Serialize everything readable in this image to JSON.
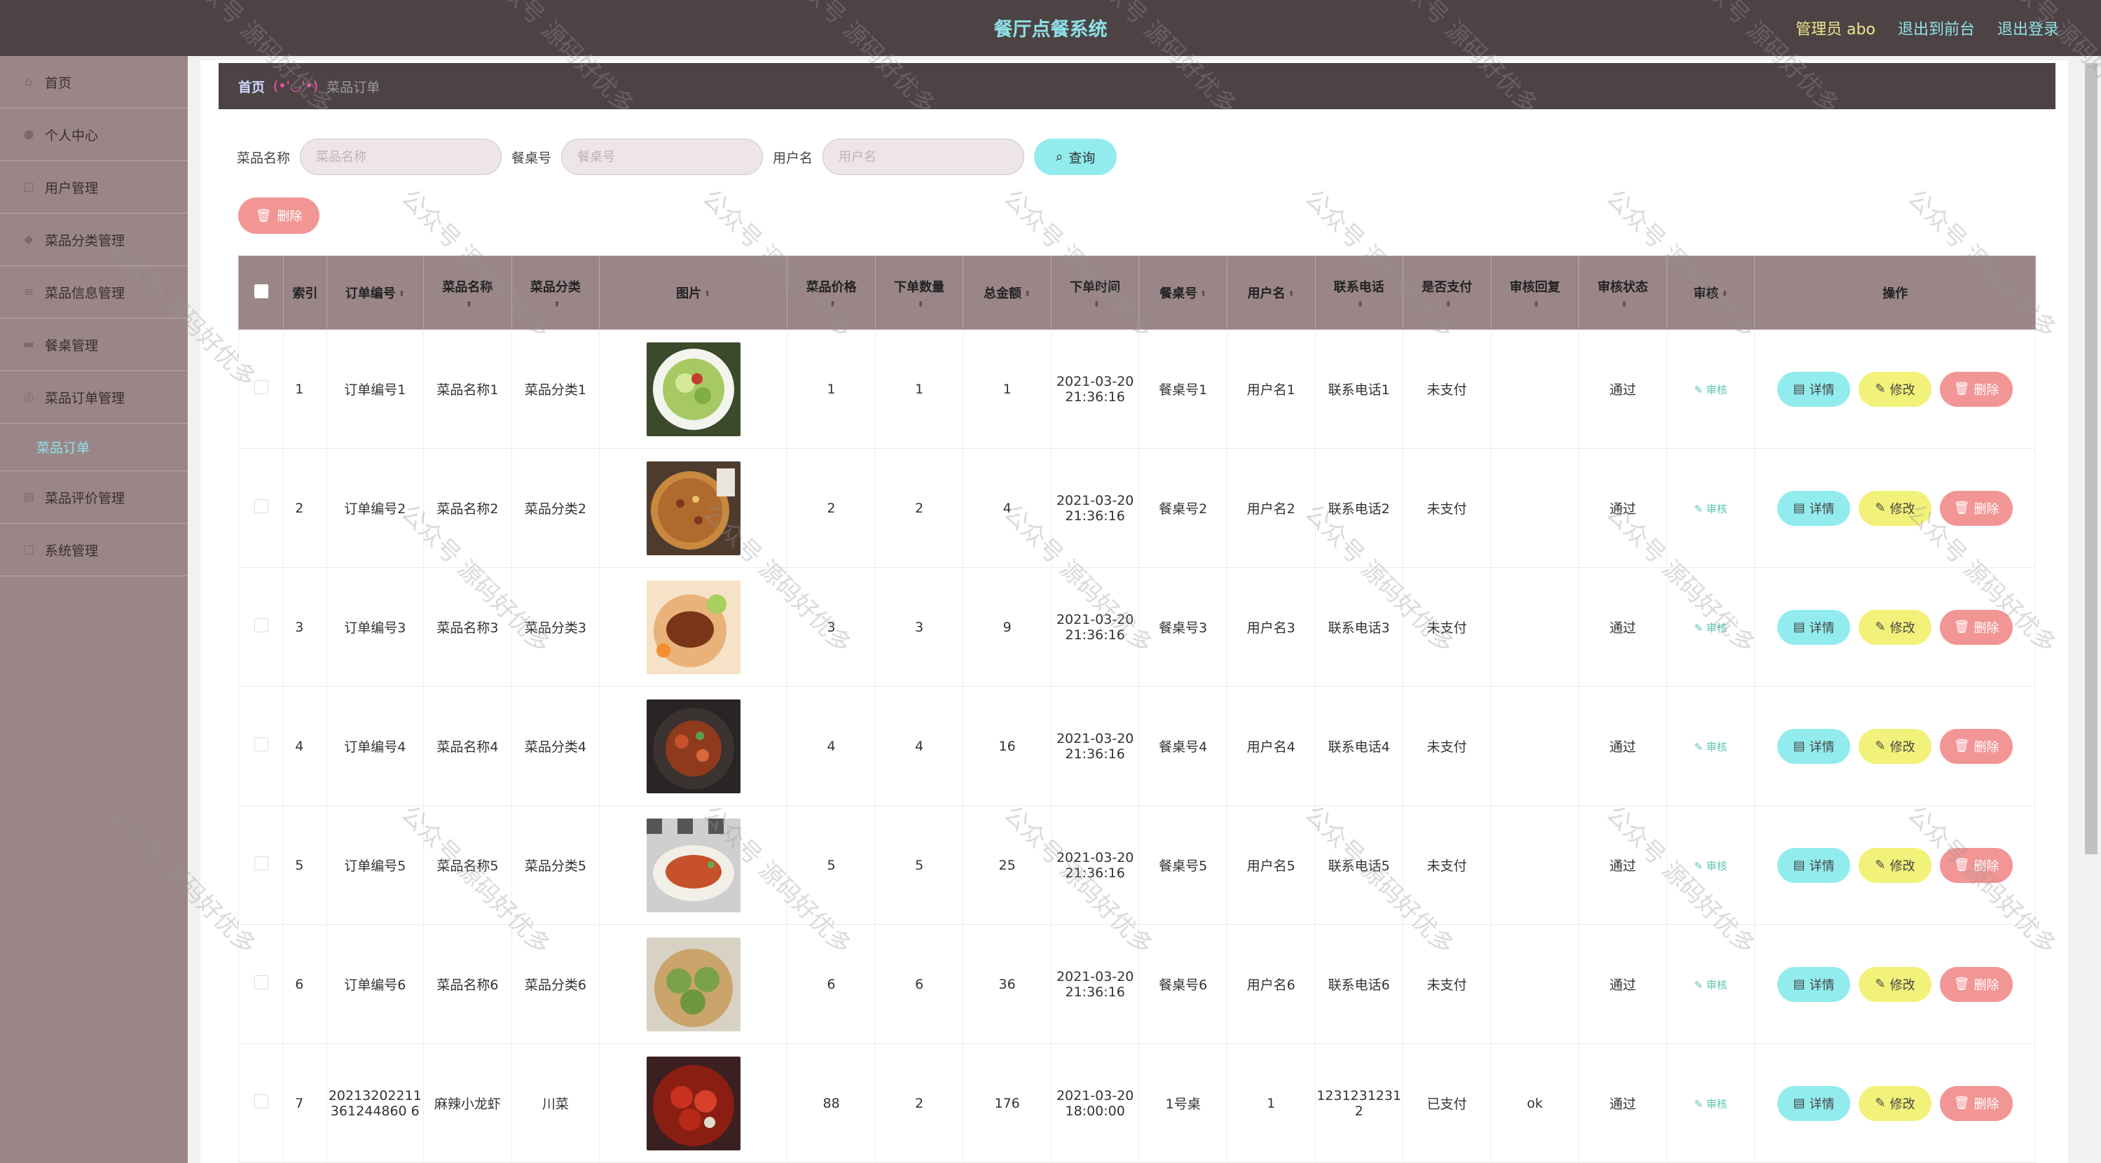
{
  "header": {
    "title": "餐厅点餐系统",
    "admin_label": "管理员 abo",
    "to_front": "退出到前台",
    "logout": "退出登录"
  },
  "sidebar": {
    "items": [
      {
        "label": "首页",
        "icon": "home-icon"
      },
      {
        "label": "个人中心",
        "icon": "user-icon"
      },
      {
        "label": "用户管理",
        "icon": "users-icon"
      },
      {
        "label": "菜品分类管理",
        "icon": "tag-icon"
      },
      {
        "label": "菜品信息管理",
        "icon": "list-icon"
      },
      {
        "label": "餐桌管理",
        "icon": "table-icon"
      },
      {
        "label": "菜品订单管理",
        "icon": "order-icon"
      }
    ],
    "sub_item": "菜品订单",
    "items_after": [
      {
        "label": "菜品评价管理",
        "icon": "comment-icon"
      },
      {
        "label": "系统管理",
        "icon": "settings-icon"
      }
    ]
  },
  "breadcrumb": {
    "home": "首页",
    "separator": "(•'◡'•)",
    "current": "菜品订单"
  },
  "search": {
    "dish_label": "菜品名称",
    "dish_placeholder": "菜品名称",
    "table_label": "餐桌号",
    "table_placeholder": "餐桌号",
    "user_label": "用户名",
    "user_placeholder": "用户名",
    "query_button": "查询"
  },
  "delete_button": "删除",
  "table": {
    "headers": [
      "索引",
      "订单编号",
      "菜品名称",
      "菜品分类",
      "图片",
      "菜品价格",
      "下单数量",
      "总金额",
      "下单时间",
      "餐桌号",
      "用户名",
      "联系电话",
      "是否支付",
      "审核回复",
      "审核状态",
      "审核",
      "操作"
    ],
    "action_labels": {
      "audit": "审核",
      "detail": "详情",
      "edit": "修改",
      "delete": "删除"
    },
    "rows": [
      {
        "idx": "1",
        "order": "订单编号1",
        "dish": "菜品名称1",
        "cat": "菜品分类1",
        "price": "1",
        "qty": "1",
        "total": "1",
        "time": "2021-03-20 21:36:16",
        "tableno": "餐桌号1",
        "user": "用户名1",
        "phone": "联系电话1",
        "paid": "未支付",
        "reply": "",
        "status": "通过"
      },
      {
        "idx": "2",
        "order": "订单编号2",
        "dish": "菜品名称2",
        "cat": "菜品分类2",
        "price": "2",
        "qty": "2",
        "total": "4",
        "time": "2021-03-20 21:36:16",
        "tableno": "餐桌号2",
        "user": "用户名2",
        "phone": "联系电话2",
        "paid": "未支付",
        "reply": "",
        "status": "通过"
      },
      {
        "idx": "3",
        "order": "订单编号3",
        "dish": "菜品名称3",
        "cat": "菜品分类3",
        "price": "3",
        "qty": "3",
        "total": "9",
        "time": "2021-03-20 21:36:16",
        "tableno": "餐桌号3",
        "user": "用户名3",
        "phone": "联系电话3",
        "paid": "未支付",
        "reply": "",
        "status": "通过"
      },
      {
        "idx": "4",
        "order": "订单编号4",
        "dish": "菜品名称4",
        "cat": "菜品分类4",
        "price": "4",
        "qty": "4",
        "total": "16",
        "time": "2021-03-20 21:36:16",
        "tableno": "餐桌号4",
        "user": "用户名4",
        "phone": "联系电话4",
        "paid": "未支付",
        "reply": "",
        "status": "通过"
      },
      {
        "idx": "5",
        "order": "订单编号5",
        "dish": "菜品名称5",
        "cat": "菜品分类5",
        "price": "5",
        "qty": "5",
        "total": "25",
        "time": "2021-03-20 21:36:16",
        "tableno": "餐桌号5",
        "user": "用户名5",
        "phone": "联系电话5",
        "paid": "未支付",
        "reply": "",
        "status": "通过"
      },
      {
        "idx": "6",
        "order": "订单编号6",
        "dish": "菜品名称6",
        "cat": "菜品分类6",
        "price": "6",
        "qty": "6",
        "total": "36",
        "time": "2021-03-20 21:36:16",
        "tableno": "餐桌号6",
        "user": "用户名6",
        "phone": "联系电话6",
        "paid": "未支付",
        "reply": "",
        "status": "通过"
      },
      {
        "idx": "7",
        "order": "20213202211361244860 6",
        "dish": "麻辣小龙虾",
        "cat": "川菜",
        "price": "88",
        "qty": "2",
        "total": "176",
        "time": "2021-03-20 18:00:00",
        "tableno": "1号桌",
        "user": "1",
        "phone": "12312312312",
        "paid": "已支付",
        "reply": "ok",
        "status": "通过"
      }
    ]
  },
  "watermark": "公众号 源码好优多",
  "colors": {
    "accent": "#8ee2e8",
    "header_bg": "#4d4345",
    "sidebar_bg": "#9a8688",
    "delete": "#f29595",
    "edit": "#f2f27a"
  }
}
